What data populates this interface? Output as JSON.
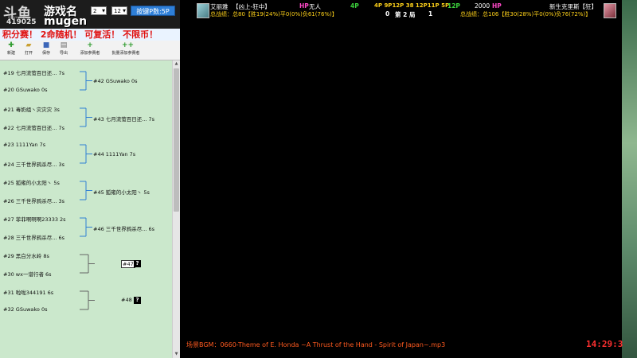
{
  "overlay": {
    "logo": "斗鱼",
    "logo_sub": "douyu.com",
    "room_id": "419025",
    "game_name": "游戏名",
    "brand": "mugen",
    "select_1": "2",
    "select_2": "12",
    "mode_button": "按键P数:5P"
  },
  "banner": "积分赛！ 2命随机！ 可复活！ 不限币！",
  "toolbar": {
    "new": "新建",
    "open": "打开",
    "save": "保存",
    "export": "导出",
    "add_player": "添加参赛者",
    "batch_add": "批量添加参赛者"
  },
  "colors": {
    "bracket_line": "#2f7fd3",
    "bracket_line_gray": "#666666",
    "panel_bg": "#cbe8cc",
    "banner_text": "#e01010",
    "hud_yellow": "#ffd21a",
    "hud_green": "#3cd23c",
    "hud_pink": "#ff48c8",
    "bgm_text": "#ff5a1f",
    "clock_text": "#ff3030"
  },
  "round1": [
    {
      "seed": "#19",
      "name": "七月流萤百日还...",
      "score": "7s"
    },
    {
      "seed": "#20",
      "name": "GSuwako",
      "score": "0s"
    },
    {
      "seed": "#21",
      "name": "毒奶组丶灾灾灾",
      "score": "3s"
    },
    {
      "seed": "#22",
      "name": "七月流萤百日还...",
      "score": "7s"
    },
    {
      "seed": "#23",
      "name": "1111Yan",
      "score": "7s"
    },
    {
      "seed": "#24",
      "name": "三千世界鸦杀尽...",
      "score": "3s"
    },
    {
      "seed": "#25",
      "name": "狐雍的小太阳丶",
      "score": "5s"
    },
    {
      "seed": "#26",
      "name": "三千世界鸦杀尽...",
      "score": "3s"
    },
    {
      "seed": "#27",
      "name": "菲菲啊啊啊23333",
      "score": "2s"
    },
    {
      "seed": "#28",
      "name": "三千世界鸦杀尽...",
      "score": "6s"
    },
    {
      "seed": "#29",
      "name": "黑白分水岭",
      "score": "8s"
    },
    {
      "seed": "#30",
      "name": "wx一谱行者",
      "score": "6s"
    },
    {
      "seed": "#31",
      "name": "啦啦344191",
      "score": "6s"
    },
    {
      "seed": "#32",
      "name": "GSuwako",
      "score": "0s"
    }
  ],
  "round2": [
    {
      "seed": "#42",
      "name": "GSuwako",
      "score": "0s"
    },
    {
      "seed": "#43",
      "name": "七月流萤百日还...",
      "score": "7s"
    },
    {
      "seed": "#44",
      "name": "1111Yan",
      "score": "7s"
    },
    {
      "seed": "#45",
      "name": "狐雍的小太阳丶",
      "score": "5s"
    },
    {
      "seed": "#46",
      "name": "三千世界鸦杀尽...",
      "score": "6s"
    }
  ],
  "pending": [
    {
      "seed": "#47",
      "mark": "?"
    },
    {
      "seed": "#48",
      "mark": "?"
    }
  ],
  "hud": {
    "p1_name": "艾丽雅",
    "p1_tag": "【凶上-狂中】",
    "p1_hp_label": "HP",
    "p1_hp_value": "无人",
    "p1_power": "4P",
    "p1_record": "总战绩：总80【胜19(24%)平0(0%)负61(76%)】",
    "mid_top": "4P  9P12P 38 12P11P 5P",
    "mid_score_left": "0",
    "mid_rank": "第 2 局",
    "mid_score_right": "1",
    "p2_power": "12P",
    "p2_hp_value": "2000",
    "p2_hp_label": "HP",
    "p2_name": "新生克里斯【狂】",
    "p2_record": "总战绩：总106【胜30(28%)平0(0%)负76(72%)】"
  },
  "bgm": "场景BGM：0660-Theme of E. Honda ~A Thrust of the Hand - Spirit of Japan~.mp3",
  "clock": "14:29:3"
}
